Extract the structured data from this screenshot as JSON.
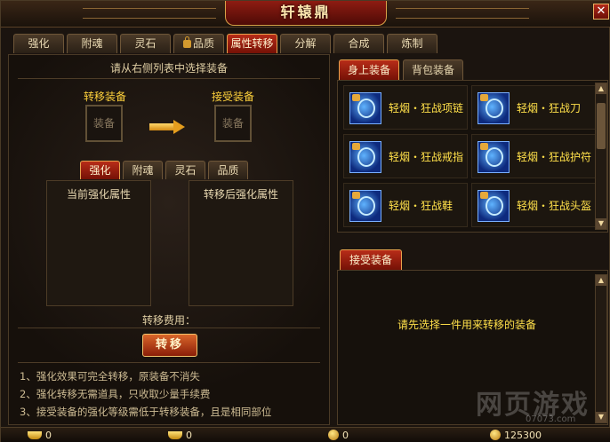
{
  "window": {
    "title": "轩辕鼎",
    "close_symbol": "✕"
  },
  "tabs": [
    {
      "label": "强化",
      "locked": false
    },
    {
      "label": "附魂",
      "locked": false
    },
    {
      "label": "灵石",
      "locked": false
    },
    {
      "label": "品质",
      "locked": true
    },
    {
      "label": "属性转移",
      "locked": false,
      "active": true
    },
    {
      "label": "分解",
      "locked": false
    },
    {
      "label": "合成",
      "locked": false
    },
    {
      "label": "炼制",
      "locked": false
    }
  ],
  "left": {
    "instruction": "请从右侧列表中选择装备",
    "source_label": "转移装备",
    "source_slot_text": "装备",
    "target_label": "接受装备",
    "target_slot_text": "装备",
    "subtabs": [
      "强化",
      "附魂",
      "灵石",
      "品质"
    ],
    "current_attr_title": "当前强化属性",
    "after_attr_title": "转移后强化属性",
    "fee_label": "转移费用：",
    "transfer_button": "转移",
    "notes": [
      "1、强化效果可完全转移，原装备不消失",
      "2、强化转移无需道具，只收取少量手续费",
      "3、接受装备的强化等级需低于转移装备，且是相同部位"
    ]
  },
  "right": {
    "tabs": [
      "身上装备",
      "背包装备"
    ],
    "equipment": [
      {
        "name": "轻烟・狂战项链",
        "icon": "necklace-icon"
      },
      {
        "name": "轻烟・狂战刀",
        "icon": "blade-icon"
      },
      {
        "name": "轻烟・狂战戒指",
        "icon": "ring-icon"
      },
      {
        "name": "轻烟・狂战护符",
        "icon": "amulet-icon"
      },
      {
        "name": "轻烟・狂战鞋",
        "icon": "boots-icon"
      },
      {
        "name": "轻烟・狂战头盔",
        "icon": "helmet-icon"
      }
    ],
    "receive_tab": "接受装备",
    "receive_message": "请先选择一件用来转移的装备"
  },
  "currency": {
    "ingot": "0",
    "bound_ingot": "0",
    "coin": "0",
    "silver": "125300"
  },
  "watermark": {
    "text": "网页游戏",
    "url": "07073.com"
  },
  "colors": {
    "accent_red": "#b72c18",
    "gold_text": "#ffe04a",
    "label_yellow": "#ffd23c"
  }
}
